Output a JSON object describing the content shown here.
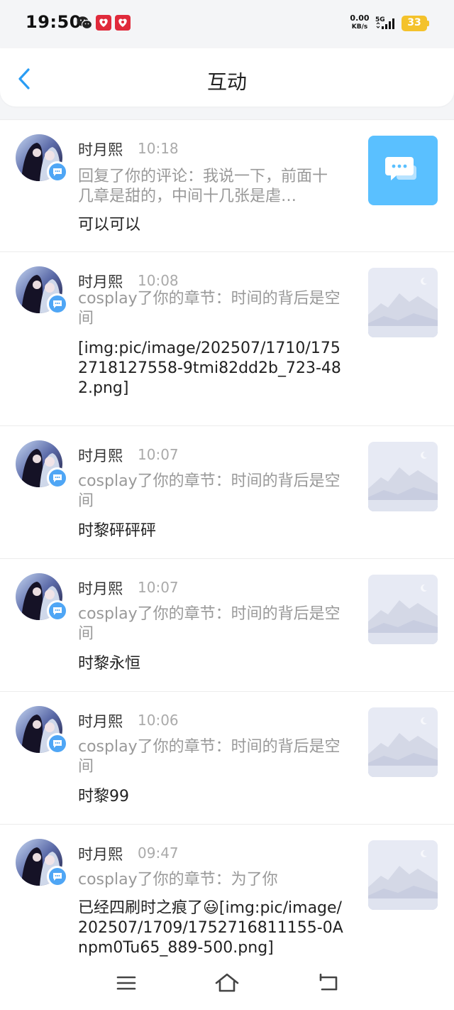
{
  "status_bar": {
    "time": "19:50",
    "net_speed_value": "0.00",
    "net_speed_unit": "KB/s",
    "network_type": "5G",
    "battery": "33",
    "colors": {
      "battery": "#f4c22b"
    }
  },
  "header": {
    "title": "互动",
    "back_icon": "chevron-left-icon",
    "accent": "#2a9df4"
  },
  "notifications": [
    {
      "user": "时月熙",
      "time": "10:18",
      "action": "回复了你的评论：我说一下，前面十几章是甜的，中间十几张是虐…",
      "content": "可以可以",
      "thumbnail": "chat-bubble-icon"
    },
    {
      "user": "时月熙",
      "time": "10:08",
      "action": "cosplay了你的章节：时间的背后是空间",
      "content": "[img:pic/image/202507/1710/1752718127558-9tmi82dd2b_723-482.png]",
      "thumbnail": "image-placeholder-icon"
    },
    {
      "user": "时月熙",
      "time": "10:07",
      "action": "cosplay了你的章节：时间的背后是空间",
      "content": "时黎砰砰砰",
      "thumbnail": "image-placeholder-icon"
    },
    {
      "user": "时月熙",
      "time": "10:07",
      "action": "cosplay了你的章节：时间的背后是空间",
      "content": "时黎永恒",
      "thumbnail": "image-placeholder-icon"
    },
    {
      "user": "时月熙",
      "time": "10:06",
      "action": "cosplay了你的章节：时间的背后是空间",
      "content": "时黎99",
      "thumbnail": "image-placeholder-icon"
    },
    {
      "user": "时月熙",
      "time": "09:47",
      "action": "cosplay了你的章节：为了你",
      "content": "已经四刷时之痕了😃[img:pic/image/202507/1709/1752716811155-0Anpm0Tu65_889-500.png]",
      "thumbnail": "image-placeholder-icon"
    }
  ],
  "nav_bar": {
    "menu_icon": "menu-icon",
    "home_icon": "home-icon",
    "back_icon": "back-icon"
  }
}
